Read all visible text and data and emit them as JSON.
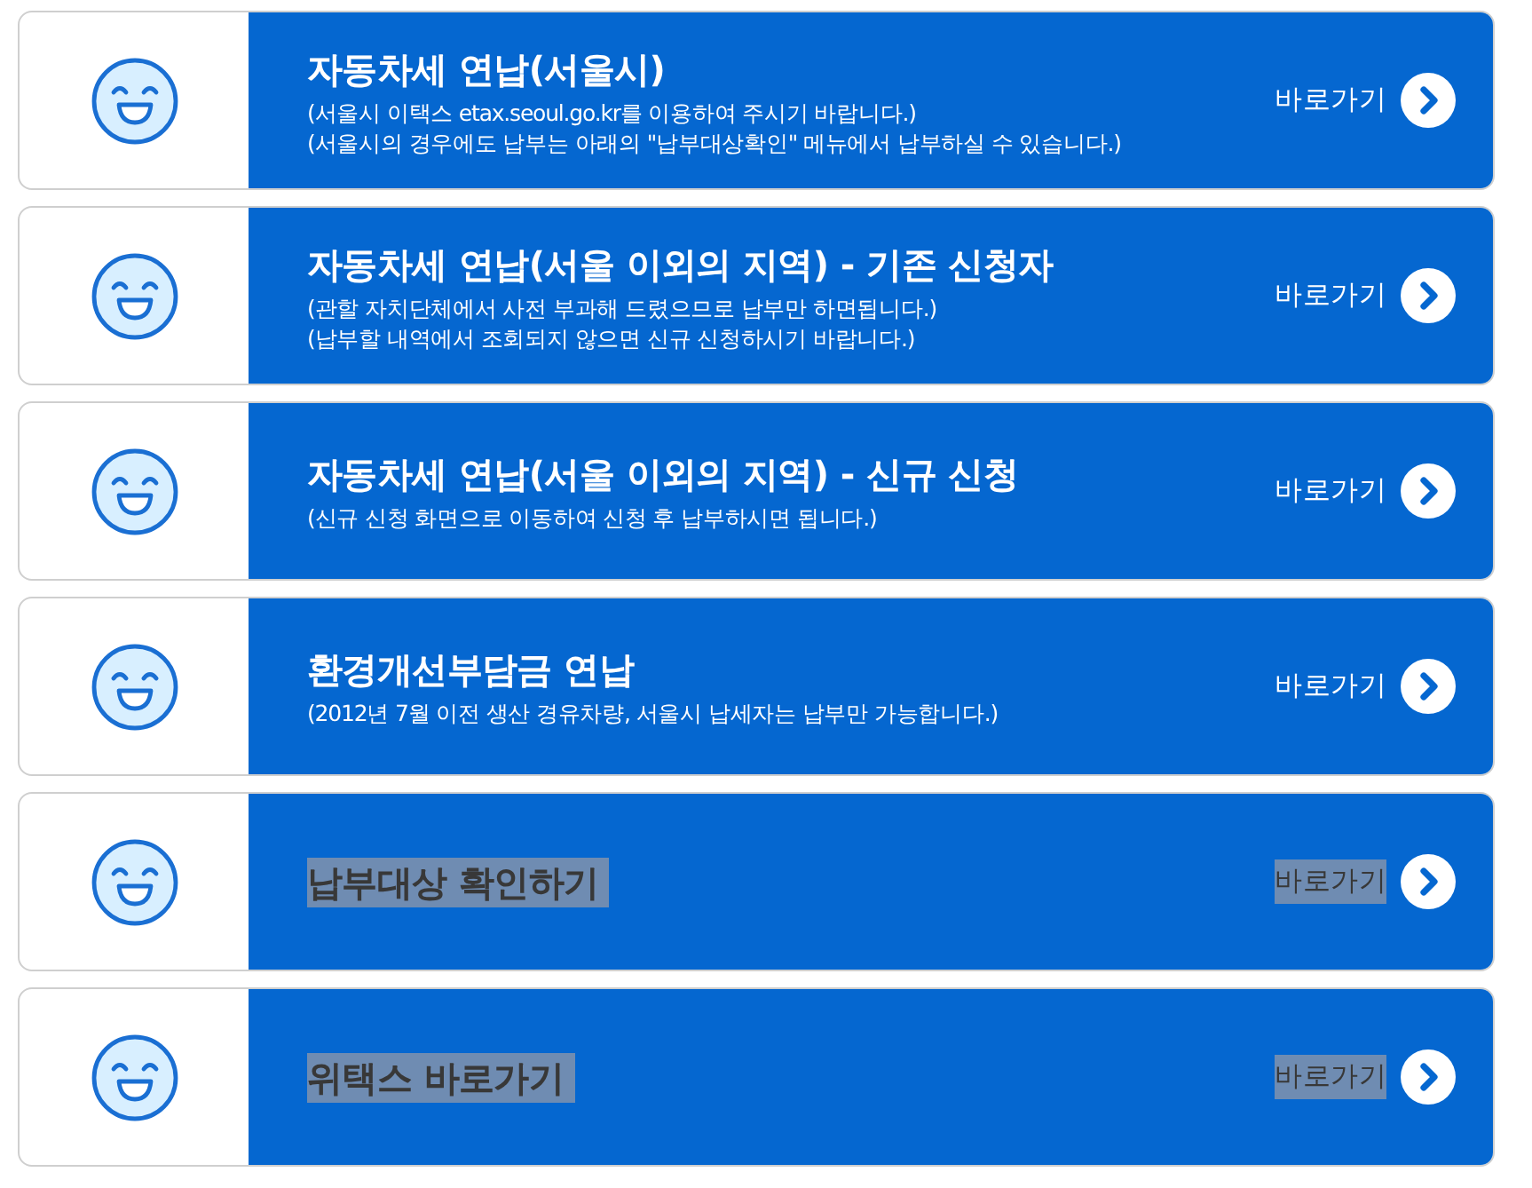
{
  "cards": [
    {
      "title": "자동차세 연납(서울시)",
      "notes": [
        "(서울시 이택스 etax.seoul.go.kr를 이용하여 주시기 바랍니다.)",
        "(서울시의 경우에도 납부는 아래의 \"납부대상확인\" 메뉴에서 납부하실 수 있습니다.)"
      ],
      "link": "바로가기",
      "highlighted": false
    },
    {
      "title": "자동차세 연납(서울 이외의 지역) - 기존 신청자",
      "notes": [
        "(관할 자치단체에서 사전 부과해 드렸으므로 납부만 하면됩니다.)",
        "(납부할 내역에서 조회되지 않으면 신규 신청하시기 바랍니다.)"
      ],
      "link": "바로가기",
      "highlighted": false
    },
    {
      "title": "자동차세 연납(서울 이외의 지역) - 신규 신청",
      "notes": [
        "(신규 신청 화면으로 이동하여 신청 후 납부하시면 됩니다.)"
      ],
      "link": "바로가기",
      "highlighted": false
    },
    {
      "title": "환경개선부담금 연납",
      "notes": [
        "(2012년 7월 이전 생산 경유차량, 서울시 납세자는 납부만 가능합니다.)"
      ],
      "link": "바로가기",
      "highlighted": false
    },
    {
      "title": "납부대상 확인하기",
      "link": "바로가기",
      "highlighted": true
    },
    {
      "title": "위택스 바로가기",
      "link": "바로가기",
      "highlighted": true
    }
  ]
}
